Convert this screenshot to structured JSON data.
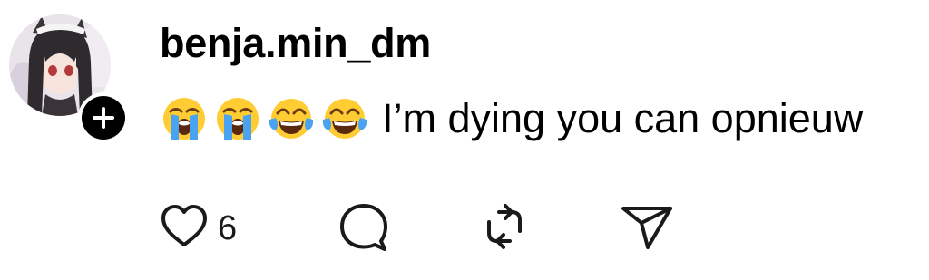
{
  "post": {
    "username": "benja.min_dm",
    "caption": {
      "emojis": [
        "loudly-crying-face",
        "loudly-crying-face",
        "face-with-tears-of-joy",
        "face-with-tears-of-joy"
      ],
      "text": "I’m dying you can opnieuw"
    },
    "actions": {
      "like_count": "6",
      "icons": [
        "heart-icon",
        "comment-icon",
        "repost-icon",
        "share-icon"
      ]
    }
  }
}
